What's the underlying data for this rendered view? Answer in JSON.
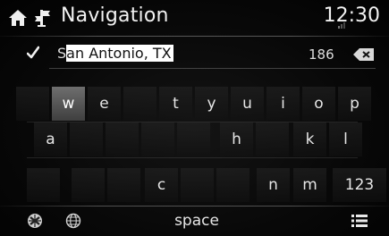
{
  "header": {
    "title": "Navigation",
    "time": "12:30",
    "icons": [
      "home-icon",
      "navigation-icon",
      "signal-icon"
    ]
  },
  "entry": {
    "typed_prefix": "S",
    "selected_completion": "an Antonio, TX",
    "match_count": "186"
  },
  "keyboard": {
    "row1": [
      "",
      "w",
      "e",
      "",
      "t",
      "y",
      "u",
      "i",
      "o",
      "p"
    ],
    "row2": [
      "a",
      "",
      "",
      "",
      "h",
      "",
      "k",
      "l"
    ],
    "row3": [
      "",
      "",
      "c",
      "",
      "",
      "n",
      "m",
      "123"
    ],
    "highlighted_key": "w"
  },
  "bottom_bar": {
    "space_label": "space",
    "icons": [
      "flag-icon",
      "globe-icon",
      "list-icon"
    ]
  },
  "colors": {
    "background": "#050505",
    "text": "#e8e8e8",
    "highlight_key": "#5a5a5a"
  }
}
